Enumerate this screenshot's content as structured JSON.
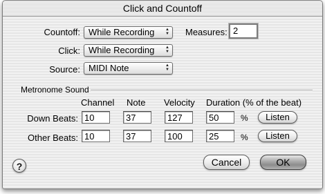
{
  "dialog": {
    "title": "Click and Countoff"
  },
  "countoff": {
    "label": "Countoff:",
    "value": "While Recording"
  },
  "measures": {
    "label": "Measures:",
    "value": "2"
  },
  "click": {
    "label": "Click:",
    "value": "While Recording"
  },
  "source": {
    "label": "Source:",
    "value": "MIDI Note"
  },
  "metronome": {
    "group_label": "Metronome Sound",
    "columns": {
      "channel": "Channel",
      "note": "Note",
      "velocity": "Velocity",
      "duration": "Duration (% of the beat)"
    },
    "rows": [
      {
        "label": "Down Beats:",
        "channel": "10",
        "note": "37",
        "velocity": "127",
        "duration": "50",
        "percent": "%",
        "listen": "Listen"
      },
      {
        "label": "Other Beats:",
        "channel": "10",
        "note": "37",
        "velocity": "100",
        "duration": "25",
        "percent": "%",
        "listen": "Listen"
      }
    ]
  },
  "buttons": {
    "cancel": "Cancel",
    "ok": "OK",
    "help": "?"
  },
  "icons": {
    "popup_arrows": "up-down-arrows-icon",
    "help": "question-mark-icon"
  }
}
